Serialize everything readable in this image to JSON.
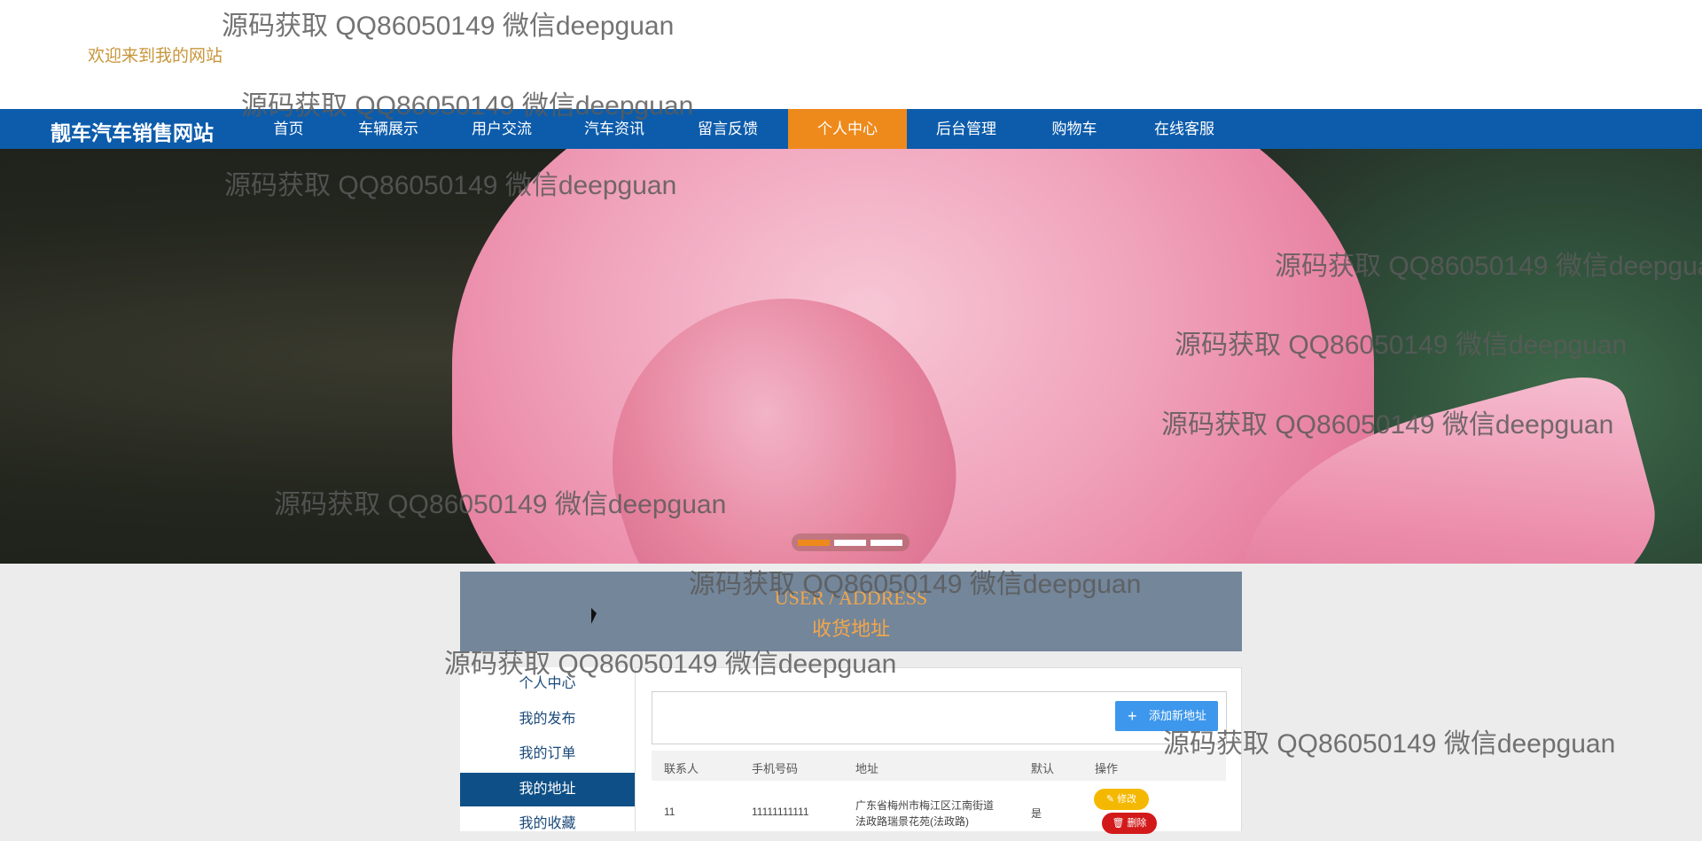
{
  "header": {
    "welcome": "欢迎来到我的网站"
  },
  "nav": {
    "brand": "靓车汽车销售网站",
    "items": [
      {
        "label": "首页"
      },
      {
        "label": "车辆展示"
      },
      {
        "label": "用户交流"
      },
      {
        "label": "汽车资讯"
      },
      {
        "label": "留言反馈"
      },
      {
        "label": "个人中心",
        "active": true
      },
      {
        "label": "后台管理"
      },
      {
        "label": "购物车"
      },
      {
        "label": "在线客服"
      }
    ],
    "active_color": "#ee8a1b",
    "bar_color": "#0d5cab"
  },
  "carousel": {
    "slides": 3,
    "active_index": 0
  },
  "section": {
    "title_en": "USER / ADDRESS",
    "title_cn": "收货地址"
  },
  "side_menu": {
    "items": [
      {
        "label": "个人中心"
      },
      {
        "label": "我的发布"
      },
      {
        "label": "我的订单"
      },
      {
        "label": "我的地址",
        "active": true
      },
      {
        "label": "我的收藏"
      }
    ]
  },
  "address": {
    "add_label": "添加新地址",
    "columns": [
      "联系人",
      "手机号码",
      "地址",
      "默认",
      "操作"
    ],
    "rows": [
      {
        "contact": "11",
        "phone": "11111111111",
        "address_line1": "广东省梅州市梅江区江南街道",
        "address_line2": "法政路瑞景花苑(法政路)",
        "is_default": "是",
        "edit_label": "修改",
        "delete_label": "删除"
      }
    ]
  },
  "watermark": "源码获取 QQ86050149 微信deepguan",
  "icons": {
    "add": "plus-icon",
    "edit": "pencil-icon",
    "delete": "trash-icon"
  }
}
